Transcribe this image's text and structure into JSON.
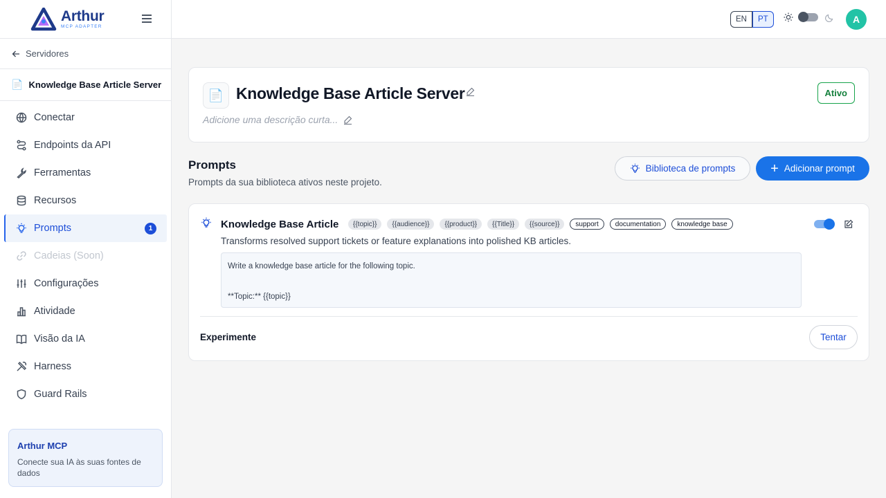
{
  "brand": {
    "name": "Arthur",
    "subtitle": "MCP ADAPTER"
  },
  "sidebar": {
    "back_label": "Servidores",
    "server_name": "Knowledge Base Article Server",
    "items": [
      {
        "label": "Conectar",
        "icon": "globe-icon"
      },
      {
        "label": "Endpoints da API",
        "icon": "route-icon"
      },
      {
        "label": "Ferramentas",
        "icon": "wrench-icon"
      },
      {
        "label": "Recursos",
        "icon": "database-icon"
      },
      {
        "label": "Prompts",
        "icon": "lightbulb-icon",
        "active": true,
        "badge": "1"
      },
      {
        "label": "Cadeias (Soon)",
        "icon": "link-icon",
        "disabled": true
      },
      {
        "label": "Configurações",
        "icon": "sliders-icon"
      },
      {
        "label": "Atividade",
        "icon": "bar-chart-icon"
      },
      {
        "label": "Visão da IA",
        "icon": "book-icon"
      },
      {
        "label": "Harness",
        "icon": "tools-icon"
      },
      {
        "label": "Guard Rails",
        "icon": "shield-icon"
      }
    ],
    "promo": {
      "title": "Arthur MCP",
      "text": "Conecte sua IA às suas fontes de dados"
    }
  },
  "header": {
    "lang_en": "EN",
    "lang_pt": "PT",
    "avatar_initial": "A"
  },
  "server": {
    "title": "Knowledge Base Article Server",
    "description_placeholder": "Adicione uma descrição curta...",
    "status": "Ativo"
  },
  "prompts_section": {
    "title": "Prompts",
    "subtitle": "Prompts da sua biblioteca ativos neste projeto.",
    "library_button": "Biblioteca de prompts",
    "add_button": "Adicionar prompt"
  },
  "prompt": {
    "name": "Knowledge Base Article",
    "variables": [
      "{{topic}}",
      "{{audience}}",
      "{{product}}",
      "{{Title}}",
      "{{source}}"
    ],
    "labels": [
      "support",
      "documentation",
      "knowledge base"
    ],
    "description": "Transforms resolved support tickets or feature explanations into polished KB articles.",
    "template_line1": "Write a knowledge base article for the following topic.",
    "template_line2": "**Topic:** {{topic}}",
    "enabled": true,
    "experiment_label": "Experimente",
    "try_button": "Tentar"
  },
  "colors": {
    "accent": "#1a73e8",
    "active_status": "#15803d",
    "avatar": "#22c3a6"
  }
}
